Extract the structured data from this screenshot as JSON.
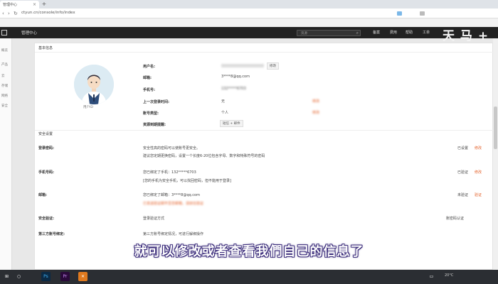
{
  "browser": {
    "tab_title": "管理中心",
    "url": "ctyun.cn/console/info/index",
    "new_tab_icon": "plus-icon",
    "nav_icons": [
      "back-icon",
      "forward-icon",
      "reload-icon"
    ]
  },
  "header": {
    "app_title": "管理中心",
    "search_placeholder": "资源",
    "nav": [
      "备案",
      "费用",
      "帮助",
      "工单",
      "..."
    ],
    "watermark": "天 马 +"
  },
  "sidebar": {
    "items": [
      "概览",
      "产品",
      "云",
      "存储",
      "网络",
      "安全"
    ]
  },
  "basic_info": {
    "section_title": "基本信息",
    "avatar_caption": "用户ID",
    "fields": [
      {
        "label": "用户名:",
        "value": ""
      },
      {
        "label": "邮箱:",
        "value": "3****8@qq.com"
      },
      {
        "label": "手机号:",
        "value": "132*****6703"
      },
      {
        "label": "上一次登录时间:",
        "value": "无"
      },
      {
        "label": "账号类型:",
        "value": "个人"
      },
      {
        "label": "资源到期提醒:",
        "value": "短信 + 邮件"
      }
    ],
    "right_links": [
      "修改",
      "修改"
    ]
  },
  "security": {
    "section_title": "安全设置",
    "rows": [
      {
        "label": "登录密码:",
        "lines": [
          "安全性高的密码可以使账号更安全。",
          "建议您定期更换密码，设置一个长度6-20位包含字母、数字和特殊符号的密码"
        ],
        "status": "已设置",
        "action": "修改"
      },
      {
        "label": "手机号码:",
        "lines": [
          "您已绑定了手机：132*****6703",
          "[您的手机为安全手机，可以找回密码，但不能用于登录]"
        ],
        "status": "已验证",
        "action": "修改"
      },
      {
        "label": "邮箱:",
        "lines": [
          "您已绑定了邮箱：3****8@qq.com",
          "已发送验证邮件至您邮箱，请前往验证"
        ],
        "status": "未验证",
        "action": "验证"
      },
      {
        "label": "安全验证:",
        "lines": [
          "登录验证方式"
        ],
        "status": "账密码认证",
        "action": ""
      },
      {
        "label": "第三方账号绑定:",
        "lines": [
          "第三方账号绑定情况，可进行解绑操作"
        ],
        "status": "",
        "action": ""
      }
    ]
  },
  "subtitle": "就可以修改或者查看我們自己的信息了",
  "taskbar": {
    "icons": [
      "windows-icon",
      "search-icon",
      "ps-icon",
      "pr-icon",
      "app-icon",
      "folder-icon"
    ],
    "clock": "20°C"
  },
  "colors": {
    "accent": "#e4622b",
    "header_bg": "#222222",
    "subtitle_outline": "#3a2b7a"
  }
}
